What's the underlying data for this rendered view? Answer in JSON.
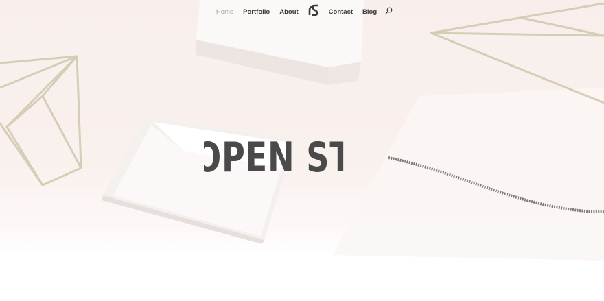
{
  "nav": {
    "items": [
      {
        "label": "Home",
        "active": true
      },
      {
        "label": "Portfolio",
        "active": false
      },
      {
        "label": "About",
        "active": false
      },
      {
        "label": "Contact",
        "active": false
      },
      {
        "label": "Blog",
        "active": false
      }
    ],
    "logo_icon": "open-studio-logo-icon",
    "search_icon": "search-icon"
  },
  "hero": {
    "title": "OPEN STUDIO"
  },
  "colors": {
    "background": "#f8efec",
    "nav_text": "#3a3a3a",
    "nav_active": "#b69a90",
    "title": "#4a4a4a"
  }
}
